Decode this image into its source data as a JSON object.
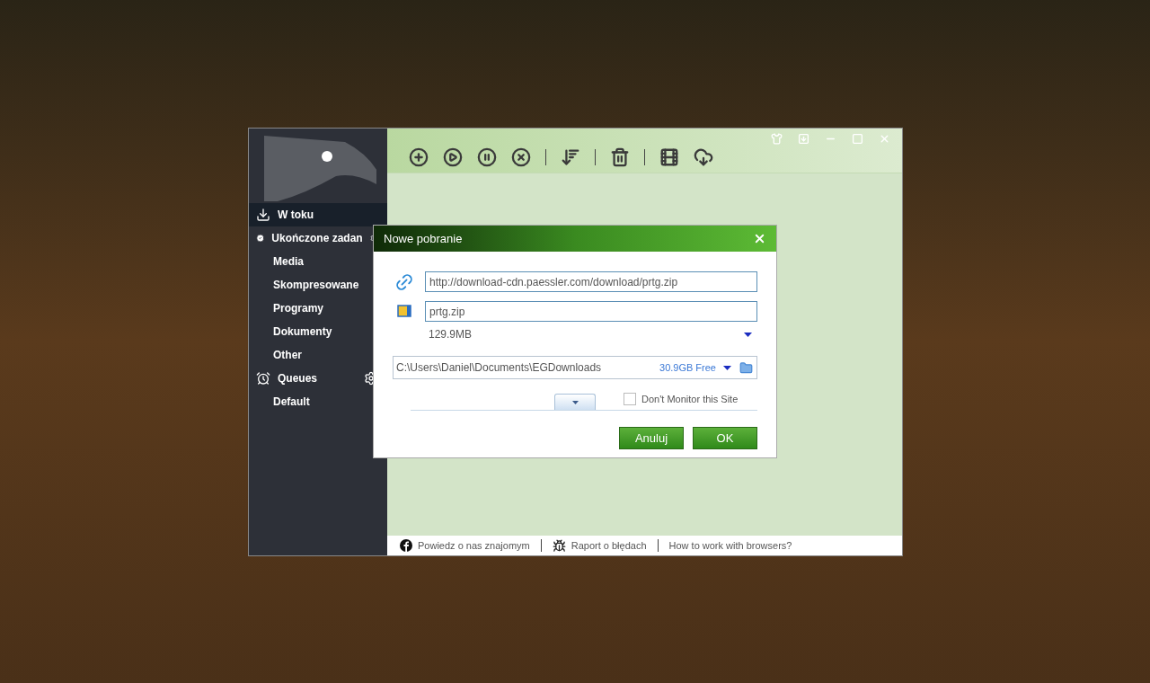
{
  "sidebar": {
    "items": [
      {
        "label": "W toku",
        "kind": "download",
        "selected": true
      },
      {
        "label": "Ukończone zadan",
        "kind": "done",
        "selected": false,
        "gear": true,
        "children": [
          {
            "label": "Media",
            "selected": false
          },
          {
            "label": "Skompresowane",
            "selected": false
          },
          {
            "label": "Programy",
            "selected": false
          },
          {
            "label": "Dokumenty",
            "selected": false
          },
          {
            "label": "Other",
            "selected": false
          }
        ]
      },
      {
        "label": "Queues",
        "kind": "queue",
        "selected": false,
        "gear": true,
        "children": [
          {
            "label": "Default",
            "selected": false
          }
        ]
      }
    ]
  },
  "dialog": {
    "title": "Nowe pobranie",
    "url": "http://download-cdn.paessler.com/download/prtg.zip",
    "filename": "prtg.zip",
    "size": "129.9MB",
    "path": "C:\\Users\\Daniel\\Documents\\EGDownloads",
    "free": "30.9GB Free",
    "dont_monitor": {
      "label": "Don't Monitor this Site",
      "checked": false
    },
    "buttons": [
      "Anuluj",
      "OK"
    ]
  },
  "footer": [
    "Powiedz o nas znajomym",
    "Raport o błędach",
    "How to work with browsers?"
  ]
}
